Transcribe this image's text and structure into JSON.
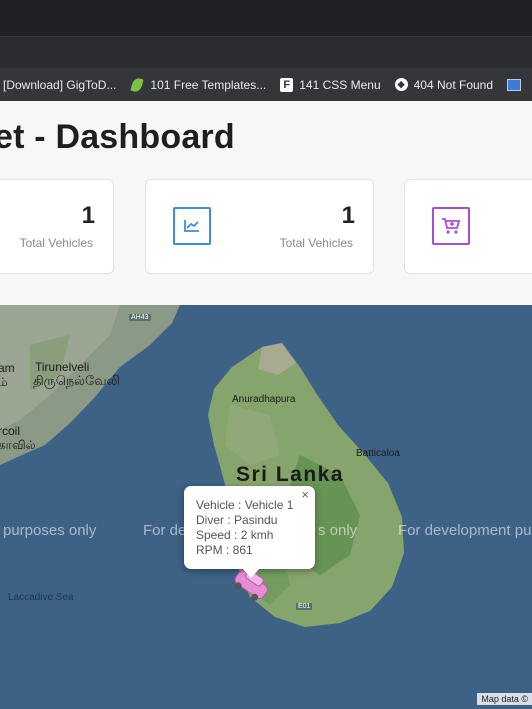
{
  "browser": {
    "bookmarks": [
      {
        "label": "[Download] GigToD...",
        "icon": "none"
      },
      {
        "label": "101 Free Templates...",
        "icon": "leaf-icon"
      },
      {
        "label": "141 CSS Menu",
        "icon": "f-logo-icon"
      },
      {
        "label": "404 Not Found",
        "icon": "globe-icon"
      }
    ]
  },
  "page": {
    "title": "et - Dashboard"
  },
  "stats": [
    {
      "count": "1",
      "label": "Total Vehicles",
      "icon": "none"
    },
    {
      "count": "1",
      "label": "Total Vehicles",
      "icon": "chart-line-icon",
      "color": "#3a8fd9"
    },
    {
      "icon": "cart-add-icon",
      "color": "#a64de0"
    }
  ],
  "map": {
    "labels": {
      "sri_lanka": "Sri Lanka",
      "anuradhapura": "Anuradhapura",
      "batticaloa": "Batticaloa",
      "tirunelveli": "Tirunelveli",
      "tirunelveli_tamil": "திருநெல்வேலி",
      "am": "am",
      "am_tamil": "ம்",
      "rcoil": "rcoil",
      "rcoil_tamil": "காவில்",
      "laccadive": "Laccadive Sea",
      "ah43": "AH43",
      "e01": "E01"
    },
    "watermarks": [
      "purposes only",
      "For de",
      "s only",
      "For development pu"
    ],
    "popup": {
      "vehicle": "Vehicle : Vehicle 1",
      "driver": "Diver : Pasindu",
      "speed": "Speed : 2 kmh",
      "rpm": "RPM : 861",
      "close": "×"
    },
    "attribution": "Map data ©"
  }
}
